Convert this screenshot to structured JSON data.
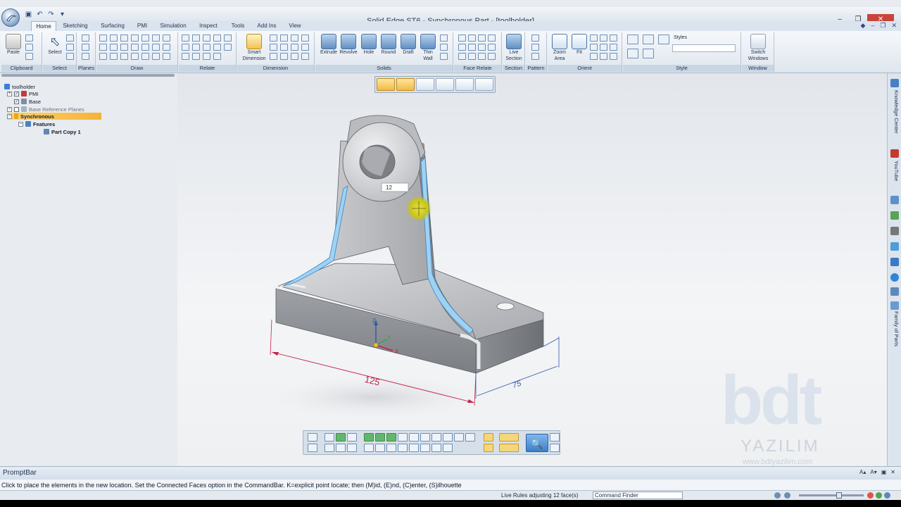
{
  "window": {
    "title": "Solid Edge ST6 - Synchronous Part - [toolholder]"
  },
  "tabs": [
    {
      "label": "Home",
      "active": true
    },
    {
      "label": "Sketching"
    },
    {
      "label": "Surfacing"
    },
    {
      "label": "PMI"
    },
    {
      "label": "Simulation"
    },
    {
      "label": "Inspect"
    },
    {
      "label": "Tools"
    },
    {
      "label": "Add Ins"
    },
    {
      "label": "View"
    }
  ],
  "ribbon": {
    "groups": {
      "clipboard": "Clipboard",
      "select": "Select",
      "planes": "Planes",
      "draw": "Draw",
      "relate": "Relate",
      "dimension": "Dimension",
      "solids": "Solids",
      "face_relate": "Face Relate",
      "section": "Section",
      "pattern": "Pattern",
      "orient": "Orient",
      "style": "Style",
      "window": "Window"
    },
    "buttons": {
      "paste": "Paste",
      "select": "Select",
      "smart_dimension_1": "Smart",
      "smart_dimension_2": "Dimension",
      "extrude": "Extrude",
      "revolve": "Revolve",
      "hole": "Hole",
      "round": "Round",
      "draft": "Draft",
      "thin_wall_1": "Thin",
      "thin_wall_2": "Wall",
      "live_section_1": "Live",
      "live_section_2": "Section",
      "zoom_area_1": "Zoom",
      "zoom_area_2": "Area",
      "fit": "Fit",
      "switch_windows_1": "Switch",
      "switch_windows_2": "Windows"
    },
    "styles_label": "Styles"
  },
  "tree": {
    "root": "toolholder",
    "items": [
      {
        "label": "PMI"
      },
      {
        "label": "Base"
      },
      {
        "label": "Base Reference Planes"
      },
      {
        "label": "Synchronous"
      },
      {
        "label": "Features"
      },
      {
        "label": "Part Copy 1"
      }
    ]
  },
  "model": {
    "edit_value": "12",
    "dim_length": "125",
    "dim_width": "75",
    "axes": {
      "x": "X",
      "y": "Y",
      "z": "Z"
    }
  },
  "right_dock": {
    "knowledge": "Knowledge Center",
    "youtube": "YouTube",
    "family": "Family of Parts"
  },
  "watermark": {
    "logo": "bdt",
    "name": "YAZILIM",
    "url": "www.bdtyazilim.com"
  },
  "promptbar": {
    "title": "PromptBar",
    "text": "Click to place the elements in the new location.  Set the Connected Faces option in the CommandBar.  K=explicit point locate; then (M)id, (E)nd, (C)enter, (S)ilhouette"
  },
  "statusbar": {
    "text": "Live Rules adjusting 12 face(s)",
    "command_finder": "Command Finder"
  },
  "colors": {
    "highlight_face": "#9fd2f2",
    "dimension": "#c8204a",
    "dimension_blue": "#3559a8",
    "selection": "#f6b23a"
  }
}
